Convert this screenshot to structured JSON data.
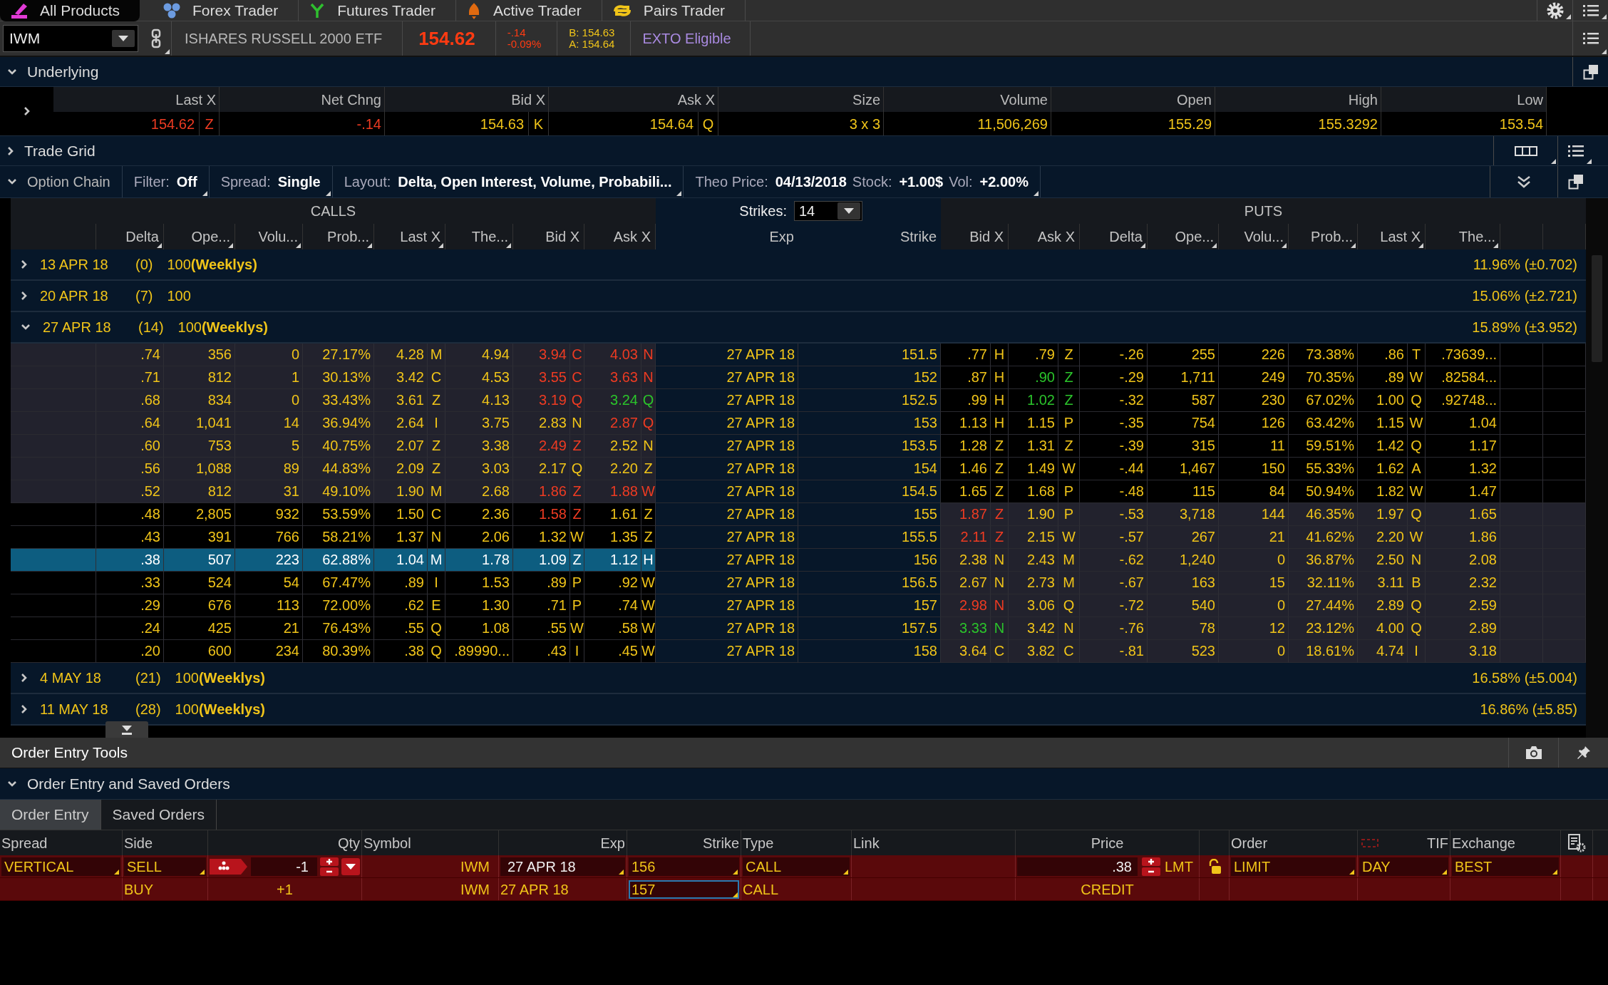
{
  "top_tabs": [
    {
      "label": "All Products",
      "kind": "products",
      "selected": true
    },
    {
      "label": "Forex Trader",
      "kind": "forex",
      "selected": false
    },
    {
      "label": "Futures Trader",
      "kind": "futures",
      "selected": false
    },
    {
      "label": "Active Trader",
      "kind": "active",
      "selected": false
    },
    {
      "label": "Pairs Trader",
      "kind": "pairs",
      "selected": false
    }
  ],
  "symbol_bar": {
    "symbol": "IWM",
    "description": "ISHARES RUSSELL 2000 ETF",
    "last": "154.62",
    "change": "-.14",
    "change_pct": "-0.09%",
    "bid": "B: 154.63",
    "ask": "A: 154.64",
    "badge": "EXTO Eligible"
  },
  "underlying": {
    "title": "Underlying",
    "expanded": true,
    "columns": [
      "Last X",
      "Net Chng",
      "Bid X",
      "Ask X",
      "Size",
      "Volume",
      "Open",
      "High",
      "Low"
    ],
    "values": [
      {
        "value": "154.62",
        "exch": "Z",
        "down": true
      },
      {
        "value": "-.14",
        "down": true
      },
      {
        "value": "154.63",
        "exch": "K",
        "down": false
      },
      {
        "value": "154.64",
        "exch": "Q",
        "down": false
      },
      {
        "value": "3 x 3",
        "down": false
      },
      {
        "value": "11,506,269",
        "down": false
      },
      {
        "value": "155.29",
        "down": false
      },
      {
        "value": "155.3292",
        "down": false
      },
      {
        "value": "153.54",
        "down": false
      }
    ]
  },
  "trade_grid": {
    "title": "Trade Grid",
    "expanded": false
  },
  "option_chain": {
    "title": "Option Chain",
    "expanded": true,
    "settings": [
      [
        {
          "label": "Filter:",
          "value": "Off"
        }
      ],
      [
        {
          "label": "Spread:",
          "value": "Single"
        }
      ],
      [
        {
          "label": "Layout:",
          "value": "Delta, Open Interest, Volume, Probabili..."
        }
      ],
      [
        {
          "label": "Theo Price:",
          "value": "04/13/2018"
        },
        {
          "label": "Stock:",
          "value": "+1.00$"
        },
        {
          "label": "Vol:",
          "value": "+2.00%"
        }
      ]
    ],
    "calls_label": "CALLS",
    "puts_label": "PUTS",
    "strikes_label": "Strikes:",
    "strikes": "14",
    "columns": [
      "Delta",
      "Ope...",
      "Volu...",
      "Prob...",
      "Last X",
      "The...",
      "Bid X",
      "Ask X",
      "Exp",
      "Strike",
      "Bid X",
      "Ask X",
      "Delta",
      "Ope...",
      "Volu...",
      "Prob...",
      "Last X",
      "The..."
    ],
    "series": [
      {
        "date": "13 APR 18",
        "count": "(0)",
        "size": "100**(Weeklys)**",
        "iv": "11.96% (±0.702)",
        "expanded": false
      },
      {
        "date": "20 APR 18",
        "count": "(7)",
        "size": "100",
        "iv": "15.06% (±2.721)",
        "expanded": false
      },
      {
        "date": "27 APR 18",
        "count": "(14)",
        "size": "100**(Weeklys)**",
        "iv": "15.89% (±3.952)",
        "expanded": true,
        "options": [
          {
            "selected": false,
            "exp": "27 APR 18",
            "strike": "151.5",
            "call": {
              "itm": true,
              "delta": ".74",
              "oi": "356",
              "vol": "0",
              "prob": "27.17%",
              "last": "4.28",
              "last_x": "M",
              "theo": "4.94",
              "bid": {
                "value": "3.94",
                "exch": "C",
                "down": true,
                "up": false
              },
              "ask": {
                "value": "4.03",
                "exch": "N",
                "down": true,
                "up": false
              }
            },
            "put": {
              "itm": false,
              "bid": {
                "value": ".77",
                "exch": "H",
                "down": false,
                "up": false
              },
              "ask": {
                "value": ".79",
                "exch": "Z",
                "down": false,
                "up": false
              },
              "delta": "-.26",
              "oi": "255",
              "vol": "226",
              "prob": "73.38%",
              "last": ".86",
              "last_x": "T",
              "theo": ".73639..."
            }
          },
          {
            "selected": false,
            "exp": "27 APR 18",
            "strike": "152",
            "call": {
              "itm": true,
              "delta": ".71",
              "oi": "812",
              "vol": "1",
              "prob": "30.13%",
              "last": "3.42",
              "last_x": "C",
              "theo": "4.53",
              "bid": {
                "value": "3.55",
                "exch": "C",
                "down": true,
                "up": false
              },
              "ask": {
                "value": "3.63",
                "exch": "N",
                "down": true,
                "up": false
              }
            },
            "put": {
              "itm": false,
              "bid": {
                "value": ".87",
                "exch": "H",
                "down": false,
                "up": false
              },
              "ask": {
                "value": ".90",
                "exch": "Z",
                "down": false,
                "up": true
              },
              "delta": "-.29",
              "oi": "1,711",
              "vol": "249",
              "prob": "70.35%",
              "last": ".89",
              "last_x": "W",
              "theo": ".82584..."
            }
          },
          {
            "selected": false,
            "exp": "27 APR 18",
            "strike": "152.5",
            "call": {
              "itm": true,
              "delta": ".68",
              "oi": "834",
              "vol": "0",
              "prob": "33.43%",
              "last": "3.61",
              "last_x": "Z",
              "theo": "4.13",
              "bid": {
                "value": "3.19",
                "exch": "Q",
                "down": true,
                "up": false
              },
              "ask": {
                "value": "3.24",
                "exch": "Q",
                "down": false,
                "up": true
              }
            },
            "put": {
              "itm": false,
              "bid": {
                "value": ".99",
                "exch": "H",
                "down": false,
                "up": false
              },
              "ask": {
                "value": "1.02",
                "exch": "Z",
                "down": false,
                "up": true
              },
              "delta": "-.32",
              "oi": "587",
              "vol": "230",
              "prob": "67.02%",
              "last": "1.00",
              "last_x": "Q",
              "theo": ".92748..."
            }
          },
          {
            "selected": false,
            "exp": "27 APR 18",
            "strike": "153",
            "call": {
              "itm": true,
              "delta": ".64",
              "oi": "1,041",
              "vol": "14",
              "prob": "36.94%",
              "last": "2.64",
              "last_x": "I",
              "theo": "3.75",
              "bid": {
                "value": "2.83",
                "exch": "N",
                "down": false,
                "up": false
              },
              "ask": {
                "value": "2.87",
                "exch": "Q",
                "down": true,
                "up": false
              }
            },
            "put": {
              "itm": false,
              "bid": {
                "value": "1.13",
                "exch": "H",
                "down": false,
                "up": false
              },
              "ask": {
                "value": "1.15",
                "exch": "P",
                "down": false,
                "up": false
              },
              "delta": "-.35",
              "oi": "754",
              "vol": "126",
              "prob": "63.42%",
              "last": "1.15",
              "last_x": "W",
              "theo": "1.04"
            }
          },
          {
            "selected": false,
            "exp": "27 APR 18",
            "strike": "153.5",
            "call": {
              "itm": true,
              "delta": ".60",
              "oi": "753",
              "vol": "5",
              "prob": "40.75%",
              "last": "2.07",
              "last_x": "Z",
              "theo": "3.38",
              "bid": {
                "value": "2.49",
                "exch": "Z",
                "down": true,
                "up": false
              },
              "ask": {
                "value": "2.52",
                "exch": "N",
                "down": false,
                "up": false
              }
            },
            "put": {
              "itm": false,
              "bid": {
                "value": "1.28",
                "exch": "Z",
                "down": false,
                "up": false
              },
              "ask": {
                "value": "1.31",
                "exch": "Z",
                "down": false,
                "up": false
              },
              "delta": "-.39",
              "oi": "315",
              "vol": "11",
              "prob": "59.51%",
              "last": "1.42",
              "last_x": "Q",
              "theo": "1.17"
            }
          },
          {
            "selected": false,
            "exp": "27 APR 18",
            "strike": "154",
            "call": {
              "itm": true,
              "delta": ".56",
              "oi": "1,088",
              "vol": "89",
              "prob": "44.83%",
              "last": "2.09",
              "last_x": "Z",
              "theo": "3.03",
              "bid": {
                "value": "2.17",
                "exch": "Q",
                "down": false,
                "up": false
              },
              "ask": {
                "value": "2.20",
                "exch": "Z",
                "down": false,
                "up": false
              }
            },
            "put": {
              "itm": false,
              "bid": {
                "value": "1.46",
                "exch": "Z",
                "down": false,
                "up": false
              },
              "ask": {
                "value": "1.49",
                "exch": "W",
                "down": false,
                "up": false
              },
              "delta": "-.44",
              "oi": "1,467",
              "vol": "150",
              "prob": "55.33%",
              "last": "1.62",
              "last_x": "A",
              "theo": "1.32"
            }
          },
          {
            "selected": false,
            "exp": "27 APR 18",
            "strike": "154.5",
            "call": {
              "itm": true,
              "delta": ".52",
              "oi": "812",
              "vol": "31",
              "prob": "49.10%",
              "last": "1.90",
              "last_x": "M",
              "theo": "2.68",
              "bid": {
                "value": "1.86",
                "exch": "Z",
                "down": true,
                "up": false
              },
              "ask": {
                "value": "1.88",
                "exch": "W",
                "down": true,
                "up": false
              }
            },
            "put": {
              "itm": false,
              "bid": {
                "value": "1.65",
                "exch": "Z",
                "down": false,
                "up": false
              },
              "ask": {
                "value": "1.68",
                "exch": "P",
                "down": false,
                "up": false
              },
              "delta": "-.48",
              "oi": "115",
              "vol": "84",
              "prob": "50.94%",
              "last": "1.82",
              "last_x": "W",
              "theo": "1.47"
            }
          },
          {
            "selected": false,
            "exp": "27 APR 18",
            "strike": "155",
            "call": {
              "itm": false,
              "delta": ".48",
              "oi": "2,805",
              "vol": "932",
              "prob": "53.59%",
              "last": "1.50",
              "last_x": "C",
              "theo": "2.36",
              "bid": {
                "value": "1.58",
                "exch": "Z",
                "down": true,
                "up": false
              },
              "ask": {
                "value": "1.61",
                "exch": "Z",
                "down": false,
                "up": false
              }
            },
            "put": {
              "itm": true,
              "bid": {
                "value": "1.87",
                "exch": "Z",
                "down": true,
                "up": false
              },
              "ask": {
                "value": "1.90",
                "exch": "P",
                "down": false,
                "up": false
              },
              "delta": "-.53",
              "oi": "3,718",
              "vol": "144",
              "prob": "46.35%",
              "last": "1.97",
              "last_x": "Q",
              "theo": "1.65"
            }
          },
          {
            "selected": false,
            "exp": "27 APR 18",
            "strike": "155.5",
            "call": {
              "itm": false,
              "delta": ".43",
              "oi": "391",
              "vol": "766",
              "prob": "58.21%",
              "last": "1.37",
              "last_x": "N",
              "theo": "2.06",
              "bid": {
                "value": "1.32",
                "exch": "W",
                "down": false,
                "up": false
              },
              "ask": {
                "value": "1.35",
                "exch": "Z",
                "down": false,
                "up": false
              }
            },
            "put": {
              "itm": true,
              "bid": {
                "value": "2.11",
                "exch": "Z",
                "down": true,
                "up": false
              },
              "ask": {
                "value": "2.15",
                "exch": "W",
                "down": false,
                "up": false
              },
              "delta": "-.57",
              "oi": "267",
              "vol": "21",
              "prob": "41.62%",
              "last": "2.20",
              "last_x": "W",
              "theo": "1.86"
            }
          },
          {
            "selected": true,
            "exp": "27 APR 18",
            "strike": "156",
            "call": {
              "itm": false,
              "delta": ".38",
              "oi": "507",
              "vol": "223",
              "prob": "62.88%",
              "last": "1.04",
              "last_x": "M",
              "theo": "1.78",
              "bid": {
                "value": "1.09",
                "exch": "Z",
                "down": false,
                "up": false
              },
              "ask": {
                "value": "1.12",
                "exch": "H",
                "down": false,
                "up": false
              }
            },
            "put": {
              "itm": true,
              "bid": {
                "value": "2.38",
                "exch": "N",
                "down": false,
                "up": false
              },
              "ask": {
                "value": "2.43",
                "exch": "M",
                "down": false,
                "up": false
              },
              "delta": "-.62",
              "oi": "1,240",
              "vol": "0",
              "prob": "36.87%",
              "last": "2.50",
              "last_x": "N",
              "theo": "2.08"
            }
          },
          {
            "selected": false,
            "exp": "27 APR 18",
            "strike": "156.5",
            "call": {
              "itm": false,
              "delta": ".33",
              "oi": "524",
              "vol": "54",
              "prob": "67.47%",
              "last": ".89",
              "last_x": "I",
              "theo": "1.53",
              "bid": {
                "value": ".89",
                "exch": "P",
                "down": false,
                "up": false
              },
              "ask": {
                "value": ".92",
                "exch": "W",
                "down": false,
                "up": false
              }
            },
            "put": {
              "itm": true,
              "bid": {
                "value": "2.67",
                "exch": "N",
                "down": false,
                "up": false
              },
              "ask": {
                "value": "2.73",
                "exch": "M",
                "down": false,
                "up": false
              },
              "delta": "-.67",
              "oi": "163",
              "vol": "15",
              "prob": "32.11%",
              "last": "3.11",
              "last_x": "B",
              "theo": "2.32"
            }
          },
          {
            "selected": false,
            "exp": "27 APR 18",
            "strike": "157",
            "call": {
              "itm": false,
              "delta": ".29",
              "oi": "676",
              "vol": "113",
              "prob": "72.00%",
              "last": ".62",
              "last_x": "E",
              "theo": "1.30",
              "bid": {
                "value": ".71",
                "exch": "P",
                "down": false,
                "up": false
              },
              "ask": {
                "value": ".74",
                "exch": "W",
                "down": false,
                "up": false
              }
            },
            "put": {
              "itm": true,
              "bid": {
                "value": "2.98",
                "exch": "N",
                "down": true,
                "up": false
              },
              "ask": {
                "value": "3.06",
                "exch": "Q",
                "down": false,
                "up": false
              },
              "delta": "-.72",
              "oi": "540",
              "vol": "0",
              "prob": "27.44%",
              "last": "2.89",
              "last_x": "Q",
              "theo": "2.59"
            }
          },
          {
            "selected": false,
            "exp": "27 APR 18",
            "strike": "157.5",
            "call": {
              "itm": false,
              "delta": ".24",
              "oi": "425",
              "vol": "21",
              "prob": "76.43%",
              "last": ".55",
              "last_x": "Q",
              "theo": "1.08",
              "bid": {
                "value": ".55",
                "exch": "W",
                "down": false,
                "up": false
              },
              "ask": {
                "value": ".58",
                "exch": "W",
                "down": false,
                "up": false
              }
            },
            "put": {
              "itm": true,
              "bid": {
                "value": "3.33",
                "exch": "N",
                "down": false,
                "up": true
              },
              "ask": {
                "value": "3.42",
                "exch": "N",
                "down": false,
                "up": false
              },
              "delta": "-.76",
              "oi": "78",
              "vol": "12",
              "prob": "23.12%",
              "last": "4.00",
              "last_x": "Q",
              "theo": "2.89"
            }
          },
          {
            "selected": false,
            "exp": "27 APR 18",
            "strike": "158",
            "call": {
              "itm": false,
              "delta": ".20",
              "oi": "600",
              "vol": "234",
              "prob": "80.39%",
              "last": ".38",
              "last_x": "Q",
              "theo": ".89990...",
              "bid": {
                "value": ".43",
                "exch": "I",
                "down": false,
                "up": false
              },
              "ask": {
                "value": ".45",
                "exch": "W",
                "down": false,
                "up": false
              }
            },
            "put": {
              "itm": true,
              "bid": {
                "value": "3.64",
                "exch": "C",
                "down": false,
                "up": false
              },
              "ask": {
                "value": "3.82",
                "exch": "C",
                "down": false,
                "up": false
              },
              "delta": "-.81",
              "oi": "523",
              "vol": "0",
              "prob": "18.61%",
              "last": "4.74",
              "last_x": "I",
              "theo": "3.18"
            }
          }
        ]
      },
      {
        "date": "4 MAY 18",
        "count": "(21)",
        "size": "100**(Weeklys)**",
        "iv": "16.58% (±5.004)",
        "expanded": false
      },
      {
        "date": "11 MAY 18",
        "count": "(28)",
        "size": "100**(Weeklys)**",
        "iv": "16.86% (±5.85)",
        "expanded": false
      }
    ]
  },
  "order_entry": {
    "tools_title": "Order Entry Tools",
    "section_title": "Order Entry and Saved Orders",
    "expanded": true,
    "tabs": [
      {
        "label": "Order Entry",
        "selected": true
      },
      {
        "label": "Saved Orders",
        "selected": false
      }
    ],
    "columns": [
      "Spread",
      "Side",
      "Qty",
      "Symbol",
      "Exp",
      "Strike",
      "Type",
      "Link",
      "Price",
      "Order",
      "TIF",
      "Exchange"
    ],
    "legs": [
      {
        "kind": "primary",
        "spread": "VERTICAL",
        "side": "SELL",
        "qty": "-1",
        "symbol": "IWM",
        "exp": "27 APR 18",
        "strike": "156",
        "strike_focused": false,
        "type": "CALL",
        "price": ".38",
        "price_type": "LMT",
        "order": "LIMIT",
        "tif": "DAY",
        "exchange": "BEST"
      },
      {
        "kind": "secondary",
        "side": "BUY",
        "qty": "+1",
        "symbol": "IWM",
        "exp": "27 APR 18",
        "strike": "157",
        "strike_focused": true,
        "type": "CALL",
        "price": "CREDIT"
      }
    ]
  }
}
